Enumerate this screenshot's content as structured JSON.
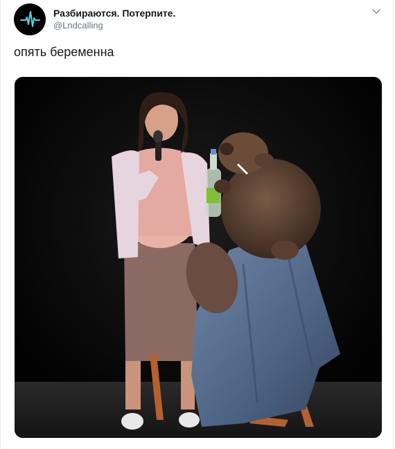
{
  "tweet": {
    "author_name": "Разбираются. Потерпите.",
    "author_handle": "@Lndcalling",
    "text": "опять беременна"
  },
  "icons": {
    "avatar": "pulse-waveform-icon",
    "menu": "chevron-down-icon"
  },
  "colors": {
    "avatar_bg": "#000000",
    "avatar_wave": "#4fd6e6",
    "handle": "#657786",
    "text": "#14171a",
    "border": "#e6ecf0"
  }
}
